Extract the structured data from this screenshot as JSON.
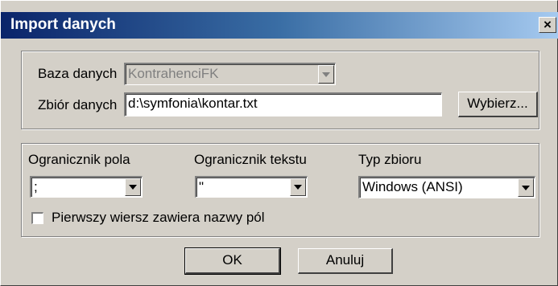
{
  "window": {
    "title": "Import danych",
    "close_glyph": "×"
  },
  "source": {
    "database_label": "Baza danych",
    "database_value": "KontrahenciFK",
    "file_label": "Zbiór danych",
    "file_value": "d:\\symfonia\\kontar.txt",
    "browse_label": "Wybierz..."
  },
  "options": {
    "field_delim_label": "Ogranicznik pola",
    "field_delim_value": ";",
    "text_delim_label": "Ogranicznik tekstu",
    "text_delim_value": "\"",
    "filetype_label": "Typ zbioru",
    "filetype_value": "Windows (ANSI)",
    "header_checkbox_label": "Pierwszy wiersz zawiera nazwy pól",
    "header_checkbox_checked": false
  },
  "buttons": {
    "ok": "OK",
    "cancel": "Anuluj"
  }
}
